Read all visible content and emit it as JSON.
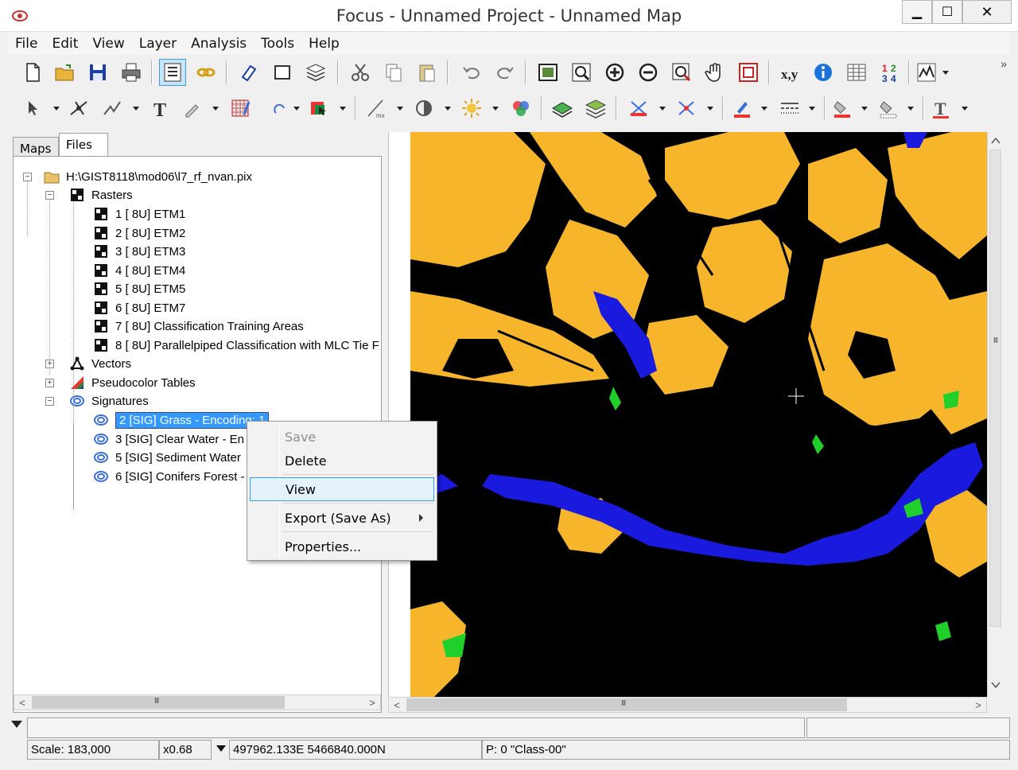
{
  "window": {
    "title": "Focus - Unnamed Project - Unnamed Map",
    "controls": {
      "minimize": "▁",
      "maximize": "☐",
      "close": "✕"
    }
  },
  "menubar": [
    "File",
    "Edit",
    "View",
    "Layer",
    "Analysis",
    "Tools",
    "Help"
  ],
  "toolbar": {
    "overflow_label": "»"
  },
  "tabs": [
    {
      "label": "Maps",
      "active": false
    },
    {
      "label": "Files",
      "active": true
    }
  ],
  "tree": {
    "root": "H:\\GIST8118\\mod06\\l7_rf_nvan.pix",
    "rasters_label": "Rasters",
    "rasters": [
      "1 [ 8U] ETM1",
      "2 [ 8U] ETM2",
      "3 [ 8U] ETM3",
      "4 [ 8U] ETM4",
      "5 [ 8U] ETM5",
      "6 [ 8U] ETM7",
      "7 [ 8U] Classification Training Areas",
      "8 [ 8U] Parallelpiped Classification with MLC Tie F"
    ],
    "vectors_label": "Vectors",
    "pct_label": "Pseudocolor Tables",
    "signatures_label": "Signatures",
    "signatures": [
      "2 [SIG] Grass - Encoding: 1",
      "3 [SIG] Clear Water - En",
      "5 [SIG] Sediment Water",
      "6 [SIG] Conifers Forest -"
    ]
  },
  "context_menu": {
    "items": [
      {
        "label": "Save",
        "enabled": false
      },
      {
        "label": "Delete",
        "enabled": true
      },
      {
        "label": "View",
        "enabled": true,
        "highlighted": true
      },
      {
        "label": "Export (Save As)",
        "enabled": true,
        "submenu": true
      },
      {
        "label": "Properties...",
        "enabled": true
      }
    ]
  },
  "scrollbar": {
    "grip": "III"
  },
  "status": {
    "scale": "Scale: 183,000",
    "zoom": "x0.68",
    "coords": "497962.133E 5466840.000N",
    "pixel": "P:  0 \"Class-00\""
  },
  "colors": {
    "map_background": "#000000",
    "class_yellow": "#f7b52c",
    "class_blue": "#1a1adf",
    "class_green": "#1fcf2a",
    "selection": "#3399ff"
  }
}
